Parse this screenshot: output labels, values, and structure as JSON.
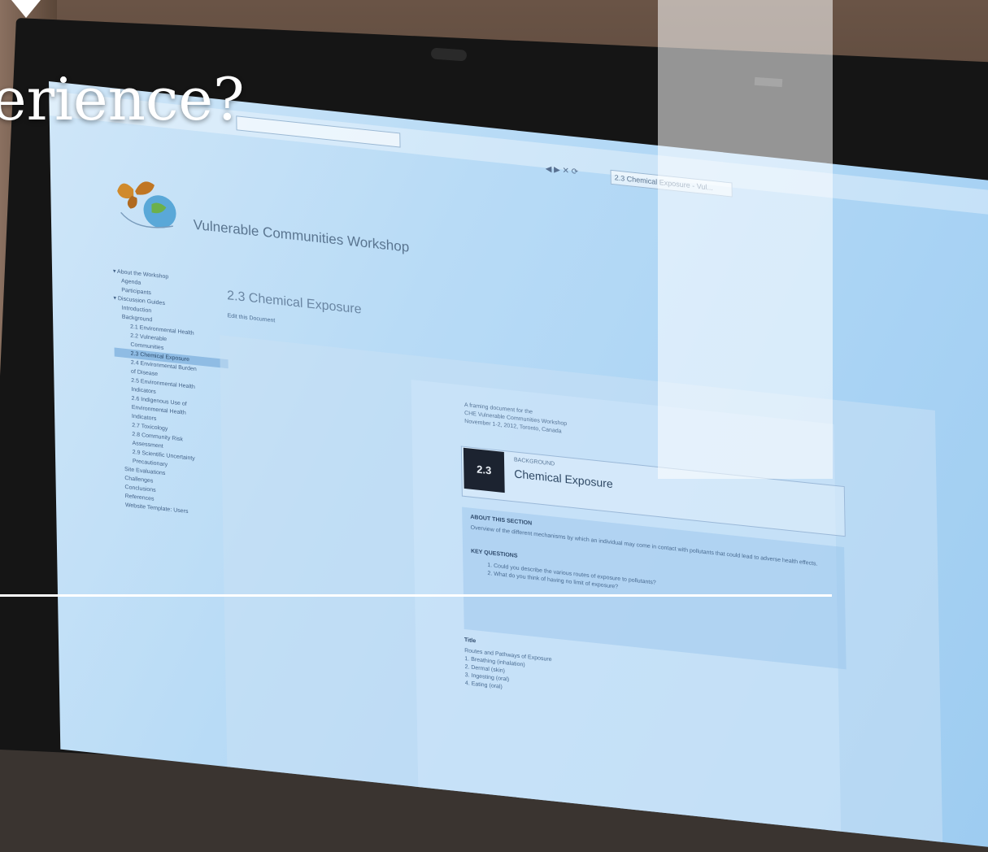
{
  "overlay": {
    "title": "erience?"
  },
  "screen": {
    "site_title": "Vulnerable Communities Workshop",
    "page_heading": "2.3 Chemical Exposure",
    "browser_tab": "2.3 Chemical Exposure - Vul...",
    "sidebar": [
      {
        "label": "About the Workshop",
        "level": 0
      },
      {
        "label": "Agenda",
        "level": 1
      },
      {
        "label": "Participants",
        "level": 1
      },
      {
        "label": "Discussion Guides",
        "level": 0
      },
      {
        "label": "Introduction",
        "level": 1
      },
      {
        "label": "Background",
        "level": 1
      },
      {
        "label": "2.1 Environmental Health",
        "level": 2
      },
      {
        "label": "2.2 Vulnerable",
        "level": 2
      },
      {
        "label": "Communities",
        "level": 2
      },
      {
        "label": "2.3 Chemical Exposure",
        "level": 2,
        "active": true
      },
      {
        "label": "2.4 Environmental Burden",
        "level": 2
      },
      {
        "label": "of Disease",
        "level": 2
      },
      {
        "label": "2.5 Environmental Health",
        "level": 2
      },
      {
        "label": "Indicators",
        "level": 2
      },
      {
        "label": "2.6 Indigenous Use of",
        "level": 2
      },
      {
        "label": "Environmental Health",
        "level": 2
      },
      {
        "label": "Indicators",
        "level": 2
      },
      {
        "label": "2.7 Toxicology",
        "level": 2
      },
      {
        "label": "2.8 Community Risk",
        "level": 2
      },
      {
        "label": "Assessment",
        "level": 2
      },
      {
        "label": "2.9 Scientific Uncertainty",
        "level": 2
      },
      {
        "label": "Precautionary",
        "level": 2
      },
      {
        "label": "Site Evaluations",
        "level": 1
      },
      {
        "label": "Challenges",
        "level": 1
      },
      {
        "label": "Conclusions",
        "level": 1
      },
      {
        "label": "References",
        "level": 1
      },
      {
        "label": "Website Template: Users",
        "level": 1
      }
    ],
    "doc": {
      "header_lines": [
        "A framing document for the",
        "CHE Vulnerable Communities Workshop",
        "November 1-2, 2012, Toronto, Canada"
      ],
      "section_number": "2.3",
      "section_kicker": "BACKGROUND",
      "section_title": "Chemical Exposure",
      "about_heading": "ABOUT THIS SECTION",
      "about_text": "Overview of the different mechanisms by which an individual may come in contact with pollutants that could lead to adverse health effects.",
      "kq_heading": "KEY QUESTIONS",
      "kq_items": [
        "Could you describe the various routes of exposure to pollutants?",
        "What do you think of having no limit of exposure?"
      ],
      "title_label": "Title",
      "title_lines": [
        "Routes and Pathways of Exposure",
        "1. Breathing (inhalation)",
        "2. Dermal (skin)",
        "3. Ingesting (oral)",
        "4. Eating (oral)"
      ]
    }
  },
  "colors": {
    "overlay_text": "#ffffff",
    "screen_bg": "#b8dbf6",
    "section_number_bg": "#1c2330"
  }
}
